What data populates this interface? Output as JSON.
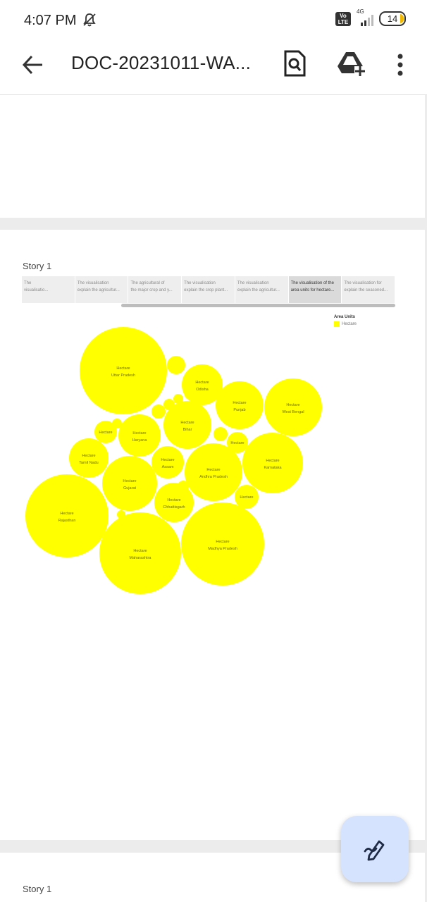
{
  "status_bar": {
    "time": "4:07 PM",
    "network": "4G",
    "volte": "Vo\nLTE",
    "battery": "14"
  },
  "app_bar": {
    "title": "DOC-20231011-WA..."
  },
  "story": {
    "label": "Story 1",
    "tabs": [
      {
        "line1": "The",
        "line2": "visualisatio..."
      },
      {
        "line1": "The visualisation",
        "line2": "explain the agricultur..."
      },
      {
        "line1": "The agricultural of",
        "line2": "the major crop and y..."
      },
      {
        "line1": "The visualisation",
        "line2": "explain the crop plant..."
      },
      {
        "line1": "The visualisation",
        "line2": "explain the agricultur..."
      },
      {
        "line1": "The visualisation of the",
        "line2": "area units for hectare..."
      },
      {
        "line1": "The visualisation for",
        "line2": "explain the seasoned..."
      }
    ],
    "active_tab": 5
  },
  "chart_data": {
    "type": "bubble",
    "legend_title": "Area Units",
    "legend_item": "Hectare",
    "color": "#ffff00",
    "series": [
      {
        "measure": "Hectare",
        "state": "Uttar Pradesh"
      },
      {
        "measure": "Hectare",
        "state": "Odisha"
      },
      {
        "measure": "Hectare",
        "state": "Punjab"
      },
      {
        "measure": "Hectare",
        "state": "West Bengal"
      },
      {
        "measure": "Hectare",
        "state": "Bihar"
      },
      {
        "measure": "Hectare",
        "state": ""
      },
      {
        "measure": "Hectare",
        "state": "Haryana"
      },
      {
        "measure": "Hectare",
        "state": ""
      },
      {
        "measure": "Hectare",
        "state": "Tamil Nadu"
      },
      {
        "measure": "Hectare",
        "state": "Assam"
      },
      {
        "measure": "Hectare",
        "state": "Andhra Pradesh"
      },
      {
        "measure": "Hectare",
        "state": "Karnataka"
      },
      {
        "measure": "Hectare",
        "state": "Gujarat"
      },
      {
        "measure": "Hectare",
        "state": "Chhattisgarh"
      },
      {
        "measure": "Hectare",
        "state": ""
      },
      {
        "measure": "Hectare",
        "state": "Rajasthan"
      },
      {
        "measure": "Hectare",
        "state": "Maharashtra"
      },
      {
        "measure": "Hectare",
        "state": "Madhya Pradesh"
      }
    ]
  },
  "next_page": {
    "label": "Story 1"
  }
}
